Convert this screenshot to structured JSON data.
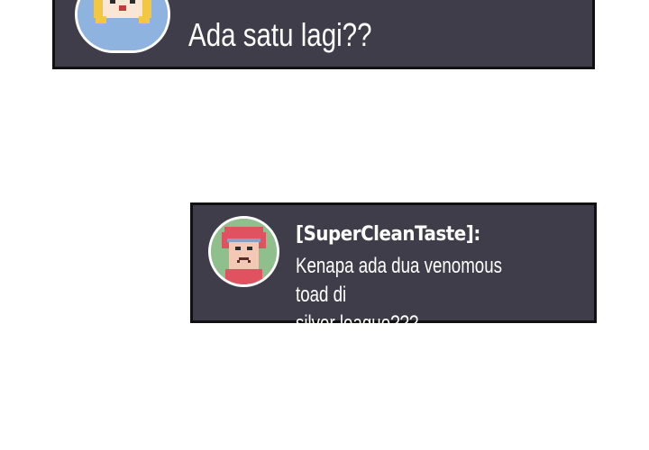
{
  "messages": [
    {
      "username": "",
      "text": "Ada satu lagi??",
      "avatar_icon": "pixel-blonde-character-icon",
      "avatar_bg": "#8fb3df"
    },
    {
      "username": "[SuperCleanTaste]:",
      "text": "Kenapa ada dua venomous toad di\nsilver league???",
      "avatar_icon": "pixel-red-hair-character-icon",
      "avatar_bg": "#8fbf8c"
    }
  ],
  "colors": {
    "box_background": "#3f3d49",
    "box_border": "#111111",
    "text": "#ffffff",
    "page_background": "#ffffff"
  }
}
